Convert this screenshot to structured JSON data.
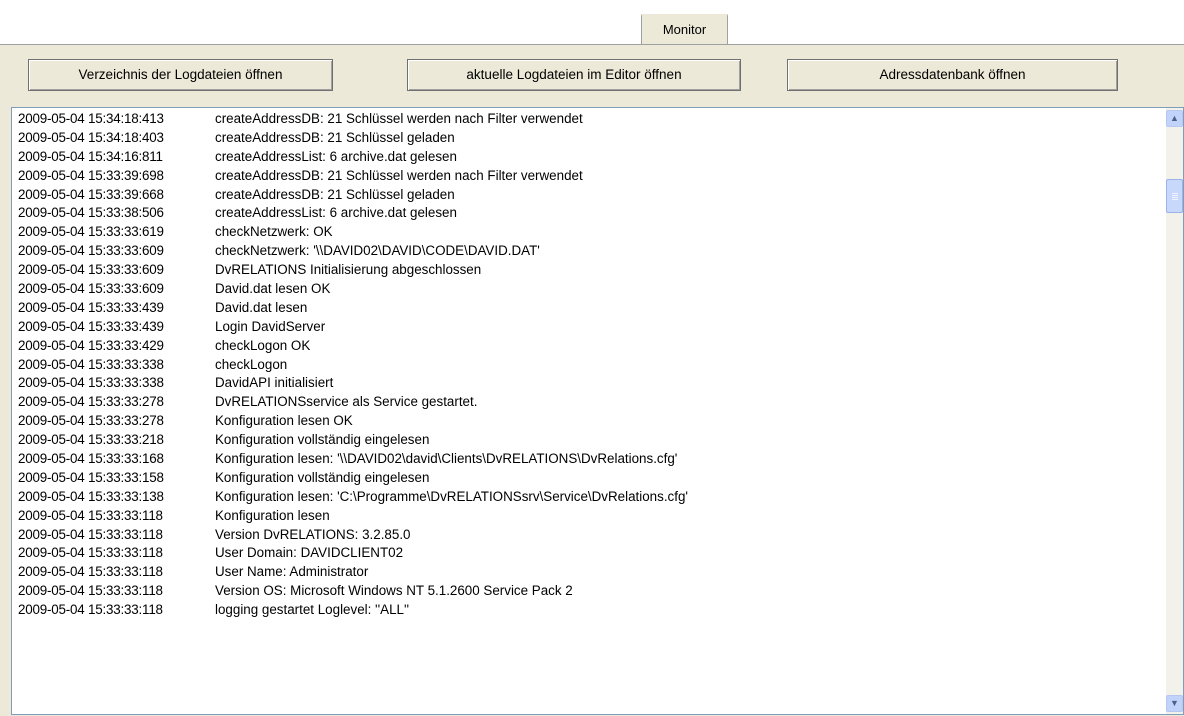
{
  "tab": {
    "label": "Monitor"
  },
  "toolbar": {
    "open_log_dir": "Verzeichnis der Logdateien öffnen",
    "open_log_editor": "aktuelle Logdateien im Editor öffnen",
    "open_address_db": "Adressdatenbank öffnen"
  },
  "log": [
    {
      "ts": "2009-05-04 15:34:18:413",
      "msg": "createAddressDB: 21 Schlüssel werden nach Filter verwendet"
    },
    {
      "ts": "2009-05-04 15:34:18:403",
      "msg": "createAddressDB: 21 Schlüssel geladen"
    },
    {
      "ts": "2009-05-04 15:34:16:811",
      "msg": "createAddressList: 6 archive.dat gelesen"
    },
    {
      "ts": "2009-05-04 15:33:39:698",
      "msg": "createAddressDB: 21 Schlüssel werden nach Filter verwendet"
    },
    {
      "ts": "2009-05-04 15:33:39:668",
      "msg": "createAddressDB: 21 Schlüssel geladen"
    },
    {
      "ts": "2009-05-04 15:33:38:506",
      "msg": "createAddressList: 6 archive.dat gelesen"
    },
    {
      "ts": "2009-05-04 15:33:33:619",
      "msg": "checkNetzwerk: OK"
    },
    {
      "ts": "2009-05-04 15:33:33:609",
      "msg": "checkNetzwerk: '\\\\DAVID02\\DAVID\\CODE\\DAVID.DAT'"
    },
    {
      "ts": "2009-05-04 15:33:33:609",
      "msg": "DvRELATIONS Initialisierung abgeschlossen"
    },
    {
      "ts": "2009-05-04 15:33:33:609",
      "msg": "David.dat lesen OK"
    },
    {
      "ts": "2009-05-04 15:33:33:439",
      "msg": "David.dat lesen"
    },
    {
      "ts": "2009-05-04 15:33:33:439",
      "msg": "Login DavidServer"
    },
    {
      "ts": "2009-05-04 15:33:33:429",
      "msg": "checkLogon OK"
    },
    {
      "ts": "2009-05-04 15:33:33:338",
      "msg": "checkLogon"
    },
    {
      "ts": "2009-05-04 15:33:33:338",
      "msg": "DavidAPI initialisiert"
    },
    {
      "ts": "2009-05-04 15:33:33:278",
      "msg": "DvRELATIONSservice als Service gestartet."
    },
    {
      "ts": "2009-05-04 15:33:33:278",
      "msg": "Konfiguration lesen OK"
    },
    {
      "ts": "2009-05-04 15:33:33:218",
      "msg": "Konfiguration vollständig eingelesen"
    },
    {
      "ts": "2009-05-04 15:33:33:168",
      "msg": "Konfiguration lesen: '\\\\DAVID02\\david\\Clients\\DvRELATIONS\\DvRelations.cfg'"
    },
    {
      "ts": "2009-05-04 15:33:33:158",
      "msg": "Konfiguration vollständig eingelesen"
    },
    {
      "ts": "2009-05-04 15:33:33:138",
      "msg": "Konfiguration lesen: 'C:\\Programme\\DvRELATIONSsrv\\Service\\DvRelations.cfg'"
    },
    {
      "ts": "2009-05-04 15:33:33:118",
      "msg": "Konfiguration lesen"
    },
    {
      "ts": "2009-05-04 15:33:33:118",
      "msg": "Version DvRELATIONS: 3.2.85.0"
    },
    {
      "ts": "2009-05-04 15:33:33:118",
      "msg": "User Domain: DAVIDCLIENT02"
    },
    {
      "ts": "2009-05-04 15:33:33:118",
      "msg": "User Name: Administrator"
    },
    {
      "ts": "2009-05-04 15:33:33:118",
      "msg": "Version OS: Microsoft Windows NT 5.1.2600 Service Pack 2"
    },
    {
      "ts": "2009-05-04 15:33:33:118",
      "msg": "logging gestartet Loglevel: ''ALL''"
    }
  ],
  "scrollbar": {
    "up_icon": "scroll-up-arrow",
    "down_icon": "scroll-down-arrow"
  },
  "colors": {
    "panel": "#ece9d8",
    "border": "#7f9db9",
    "scroll_accent": "#c1d3fb"
  }
}
